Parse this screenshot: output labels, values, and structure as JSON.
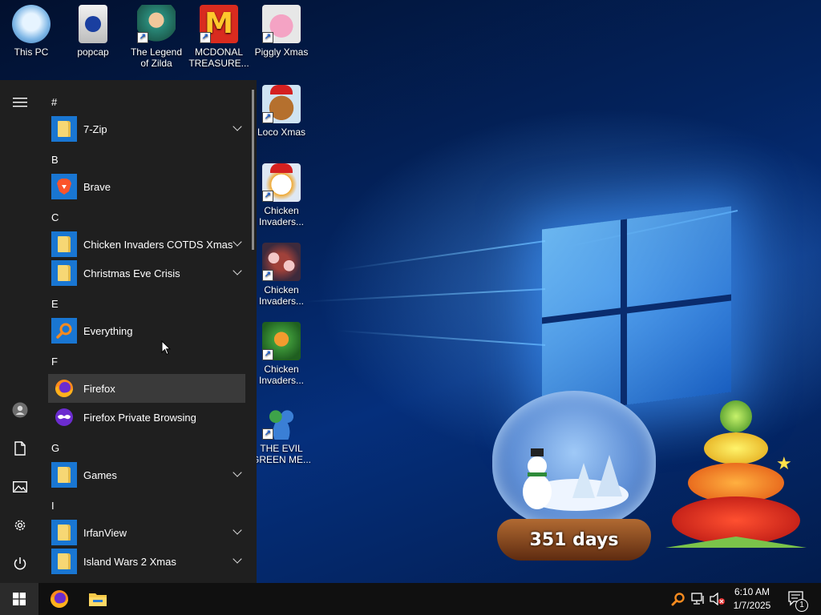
{
  "desktop": {
    "icons": [
      {
        "label": "This PC",
        "icon": "computer-icon",
        "shortcut": false
      },
      {
        "label": "popcap",
        "icon": "folder-icon",
        "shortcut": false
      },
      {
        "label": "The Legend of Zilda",
        "icon": "zilda-game-icon",
        "shortcut": true
      },
      {
        "label": "MCDONAL TREASURE...",
        "icon": "mcdonald-logo-icon",
        "shortcut": true
      },
      {
        "label": "Piggly Xmas",
        "icon": "piggly-xmas-icon",
        "shortcut": true
      },
      {
        "label": "Loco Xmas",
        "icon": "teddy-bear-icon",
        "shortcut": true
      },
      {
        "label": "Chicken Invaders...",
        "icon": "chicken-santa-icon",
        "shortcut": true
      },
      {
        "label": "Chicken Invaders...",
        "icon": "chicken-invaders-icon",
        "shortcut": true
      },
      {
        "label": "Chicken Invaders...",
        "icon": "chicken-invaders-green-icon",
        "shortcut": true
      },
      {
        "label": "THE EVIL GREEN ME...",
        "icon": "messenger-people-icon",
        "shortcut": true
      }
    ]
  },
  "start_menu": {
    "groups": [
      {
        "letter": "#",
        "items": [
          {
            "label": "7-Zip",
            "icon": "folder-icon",
            "expandable": true
          }
        ]
      },
      {
        "letter": "B",
        "items": [
          {
            "label": "Brave",
            "icon": "brave-lion-icon",
            "expandable": false
          }
        ]
      },
      {
        "letter": "C",
        "items": [
          {
            "label": "Chicken Invaders COTDS Xmas",
            "icon": "folder-icon",
            "expandable": true
          },
          {
            "label": "Christmas Eve Crisis",
            "icon": "folder-icon",
            "expandable": true
          }
        ]
      },
      {
        "letter": "E",
        "items": [
          {
            "label": "Everything",
            "icon": "magnifier-icon",
            "expandable": false
          }
        ]
      },
      {
        "letter": "F",
        "items": [
          {
            "label": "Firefox",
            "icon": "firefox-icon",
            "expandable": false
          },
          {
            "label": "Firefox Private Browsing",
            "icon": "firefox-private-icon",
            "expandable": false
          }
        ]
      },
      {
        "letter": "G",
        "items": [
          {
            "label": "Games",
            "icon": "folder-icon",
            "expandable": true
          }
        ]
      },
      {
        "letter": "I",
        "items": [
          {
            "label": "IrfanView",
            "icon": "folder-icon",
            "expandable": true
          },
          {
            "label": "Island Wars 2 Xmas",
            "icon": "folder-icon",
            "expandable": true
          }
        ]
      }
    ],
    "hovered_item": "Firefox",
    "rail": [
      "hamburger-menu-icon",
      "user-account-icon",
      "documents-icon",
      "pictures-icon",
      "settings-gear-icon",
      "power-icon"
    ]
  },
  "decorations": {
    "snow_globe_label": "351 days"
  },
  "taskbar": {
    "pinned": [
      "windows-start-icon",
      "firefox-icon",
      "file-explorer-icon"
    ],
    "tray": [
      "everything-search-icon",
      "network-icon",
      "volume-muted-icon"
    ],
    "time": "6:10 AM",
    "date": "1/7/2025",
    "notifications_count": "1"
  },
  "colors": {
    "menu_bg": "#1f1f1f",
    "hover_bg": "#3a3a3a",
    "tile_blue": "#1976d2",
    "taskbar_bg": "#101010"
  }
}
